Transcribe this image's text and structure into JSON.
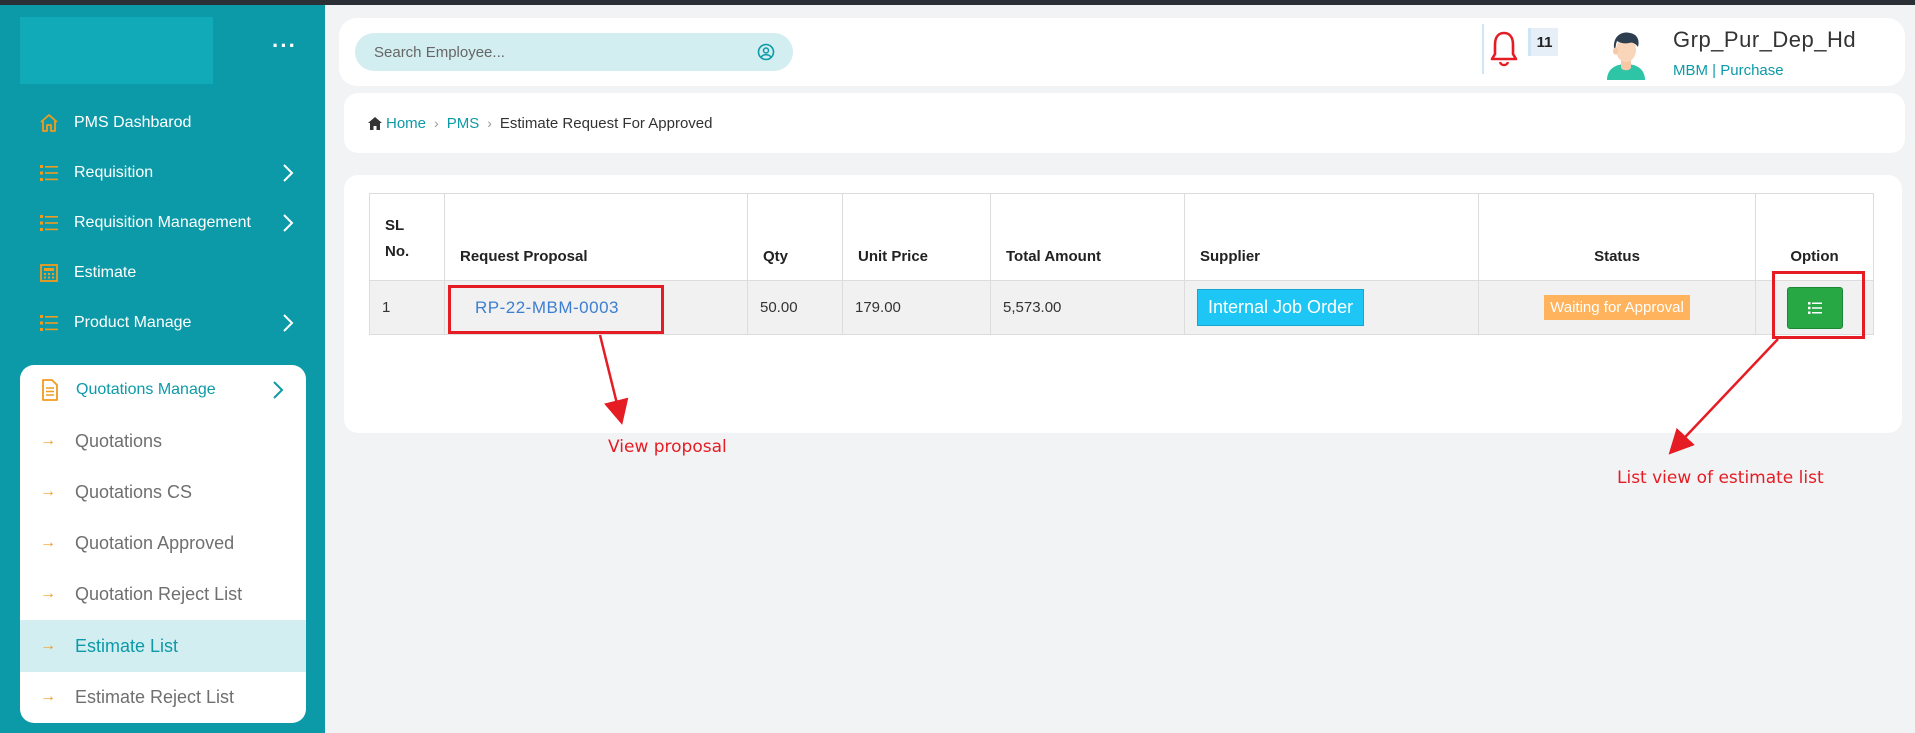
{
  "sidebar": {
    "items": [
      {
        "label": "PMS Dashbarod",
        "icon": "home-icon",
        "has_submenu": false
      },
      {
        "label": "Requisition",
        "icon": "list-icon",
        "has_submenu": true
      },
      {
        "label": "Requisition Management",
        "icon": "list-icon",
        "has_submenu": true
      },
      {
        "label": "Estimate",
        "icon": "calculator-icon",
        "has_submenu": false
      },
      {
        "label": "Product Manage",
        "icon": "list-icon",
        "has_submenu": true
      }
    ],
    "submenu": {
      "title": "Quotations Manage",
      "icon": "document-icon",
      "items": [
        {
          "label": "Quotations",
          "active": false
        },
        {
          "label": "Quotations CS",
          "active": false
        },
        {
          "label": "Quotation Approved",
          "active": false
        },
        {
          "label": "Quotation Reject List",
          "active": false
        },
        {
          "label": "Estimate List",
          "active": true
        },
        {
          "label": "Estimate Reject List",
          "active": false
        }
      ]
    }
  },
  "header": {
    "search_placeholder": "Search Employee...",
    "notification_count": "11",
    "user_name": "Grp_Pur_Dep_Hd",
    "user_role": "MBM  | Purchase"
  },
  "breadcrumb": {
    "home": "Home",
    "section": "PMS",
    "current": "Estimate Request For Approved"
  },
  "table": {
    "columns": [
      "SL No.",
      "Request Proposal",
      "Qty",
      "Unit Price",
      "Total Amount",
      "Supplier",
      "Status",
      "Option"
    ],
    "rows": [
      {
        "sl": "1",
        "proposal": "RP-22-MBM-0003",
        "qty": "50.00",
        "unit_price": "179.00",
        "total": "5,573.00",
        "supplier": "Internal Job Order",
        "status": "Waiting for Approval"
      }
    ]
  },
  "annotations": {
    "proposal_note": "View proposal",
    "option_note": "List view of estimate list"
  },
  "colors": {
    "sidebar": "#0c9aa8",
    "accent": "#f29b1d",
    "highlight": "#e51c23",
    "status": "#ffb35c",
    "option_button": "#28a745",
    "supplier_button": "#1ec6f5"
  }
}
